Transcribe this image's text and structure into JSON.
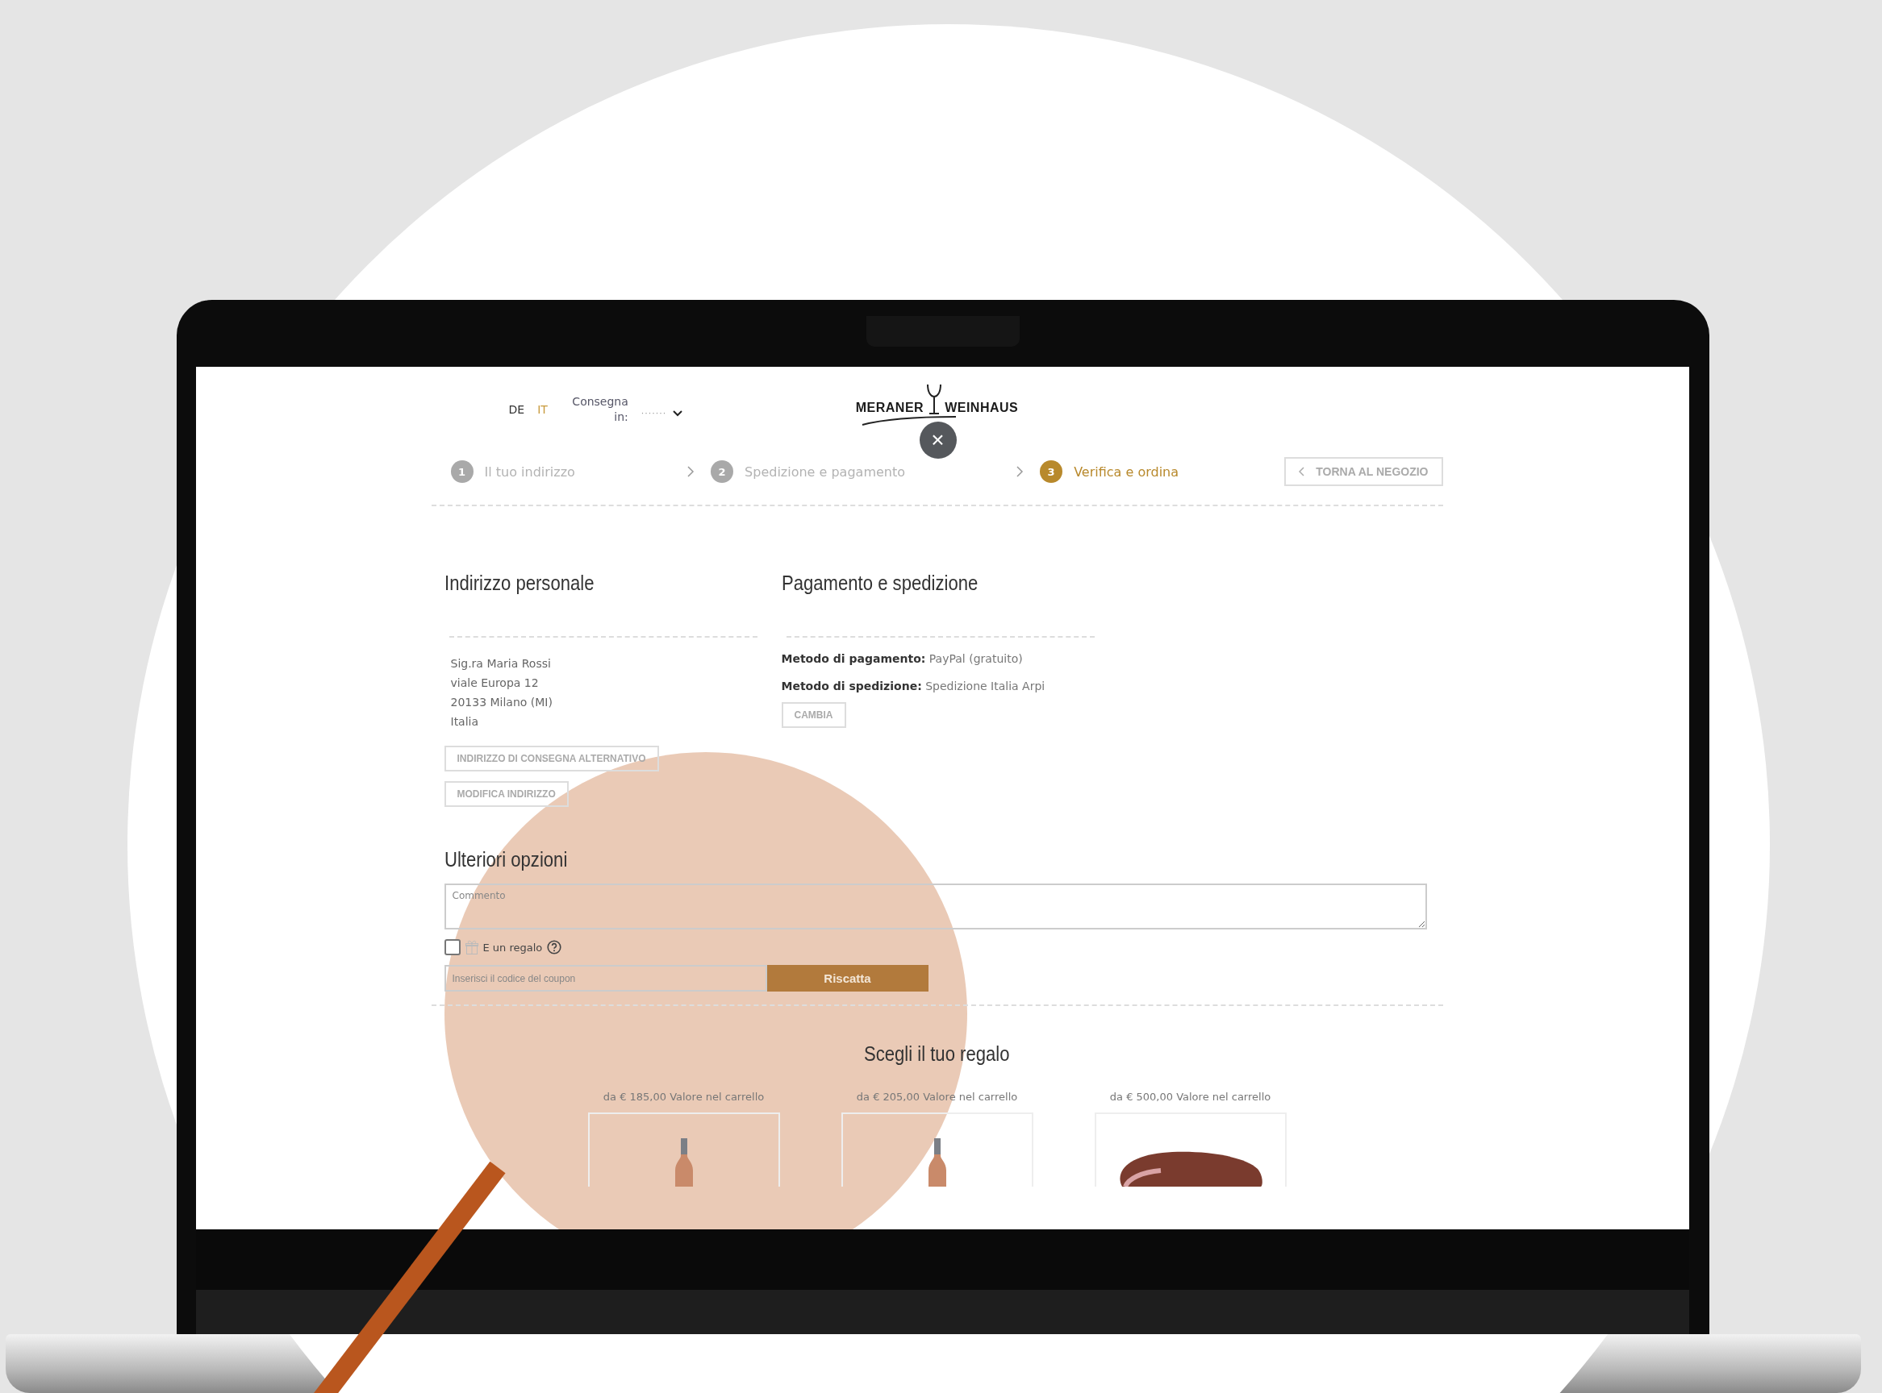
{
  "header": {
    "languages": [
      {
        "label": "DE",
        "selected": false
      },
      {
        "label": "IT",
        "selected": true
      }
    ],
    "delivery": {
      "label": "Consegna in:",
      "value": "·······"
    },
    "logo": [
      "MERANER",
      "WEINHAUS"
    ],
    "close_button": "×"
  },
  "steps": [
    {
      "number": "1",
      "label": "Il tuo indirizzo",
      "selected": false
    },
    {
      "number": "2",
      "label": "Spedizione e pagamento",
      "selected": false
    },
    {
      "number": "3",
      "label": "Verifica e ordina",
      "selected": true
    }
  ],
  "back_button": "TORNA AL NEGOZIO",
  "address": {
    "title": "Indirizzo personale",
    "lines": [
      "Sig.ra Maria Rossi",
      "viale Europa 12",
      "20133 Milano (MI)",
      "Italia"
    ],
    "buttons": [
      "INDIRIZZO DI CONSEGNA ALTERNATIVO",
      "MODIFICA INDIRIZZO"
    ]
  },
  "payment": {
    "title": "Pagamento e spedizione",
    "details": [
      {
        "label": "Metodo di pagamento:",
        "value": "PayPal (gratuito)"
      },
      {
        "label": "Metodo di spedizione:",
        "value": "Spedizione Italia Arpi"
      }
    ],
    "button": "CAMBIA"
  },
  "options": {
    "title": "Ulteriori opzioni",
    "comment": {
      "placeholder": "Commento"
    },
    "gift": {
      "label": "E un regalo",
      "checked": false
    },
    "coupon": {
      "placeholder": "Inserisci il codice del coupon",
      "button": "Riscatta"
    }
  },
  "gifts": {
    "title": "Scegli il tuo regalo",
    "items": [
      {
        "threshold": "da € 185,00 Valore nel carrello",
        "kind": "wine"
      },
      {
        "threshold": "da € 205,00 Valore nel carrello",
        "kind": "wine"
      },
      {
        "threshold": "da € 500,00 Valore nel carrello",
        "kind": "meat"
      }
    ]
  }
}
